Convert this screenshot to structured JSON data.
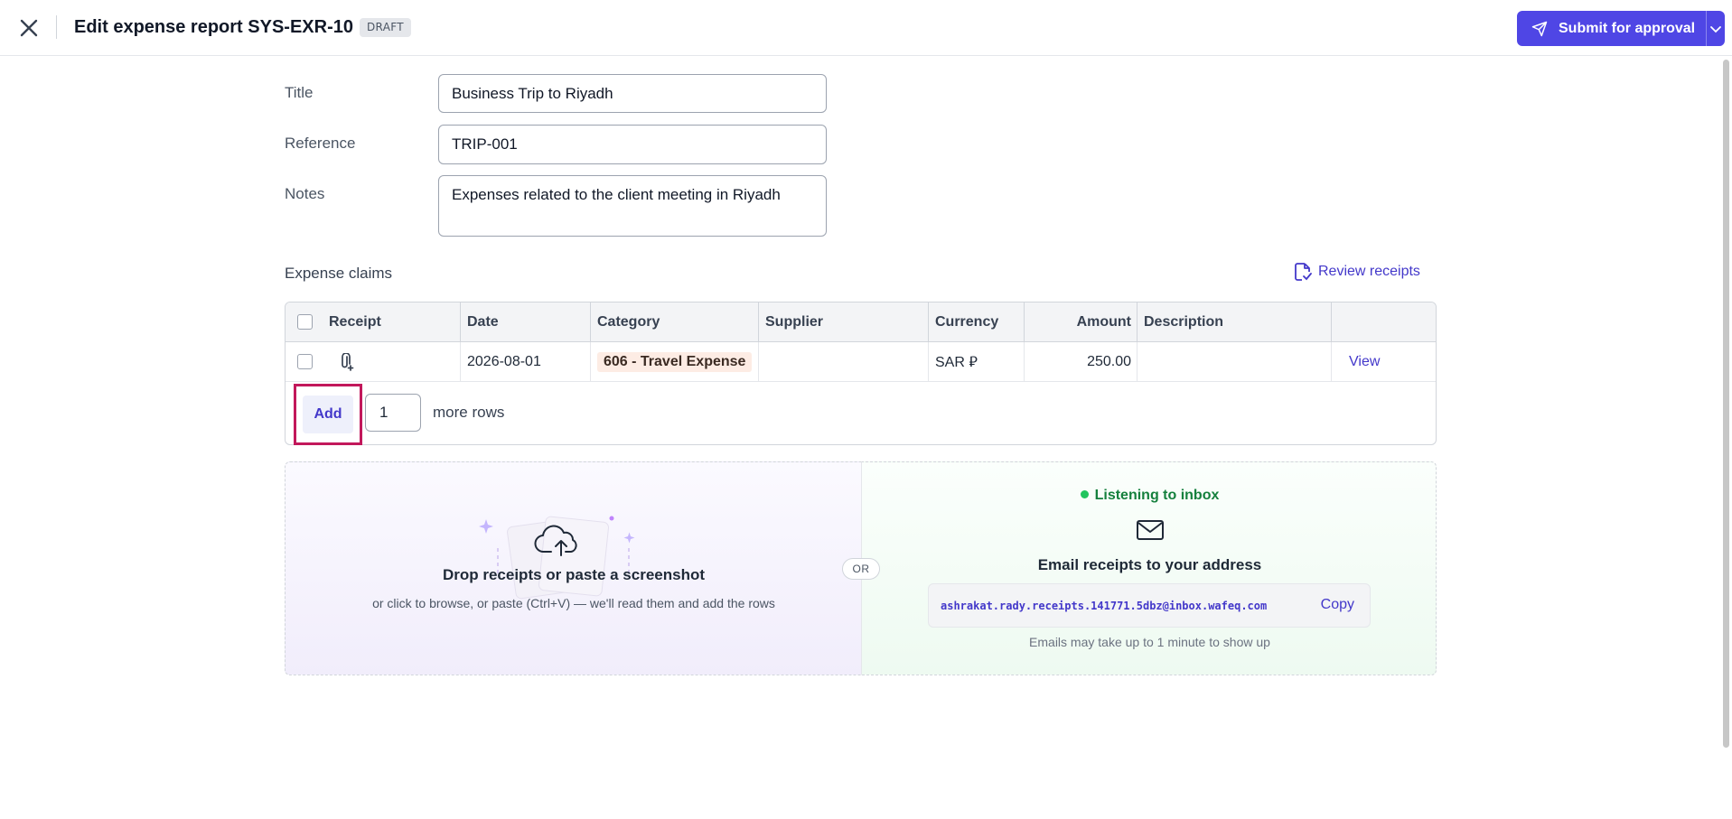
{
  "header": {
    "title": "Edit expense report SYS-EXR-10",
    "status_badge": "DRAFT",
    "submit_label": "Submit for approval"
  },
  "form": {
    "title_label": "Title",
    "title_value": "Business Trip to Riyadh",
    "reference_label": "Reference",
    "reference_value": "TRIP-001",
    "notes_label": "Notes",
    "notes_value": "Expenses related to the client meeting in Riyadh"
  },
  "claims": {
    "section_title": "Expense claims",
    "review_label": "Review receipts",
    "columns": {
      "receipt": "Receipt",
      "date": "Date",
      "category": "Category",
      "supplier": "Supplier",
      "currency": "Currency",
      "amount": "Amount",
      "description": "Description"
    },
    "rows": [
      {
        "date": "2026-08-01",
        "category": "606 - Travel Expense",
        "supplier": "",
        "currency": "SAR ⃁",
        "amount": "250.00",
        "description": "",
        "action": "View"
      }
    ],
    "add_label": "Add",
    "add_count": "1",
    "more_rows_label": "more rows"
  },
  "upload": {
    "drop_title": "Drop receipts or paste a screenshot",
    "drop_subtitle": "or click to browse, or paste (Ctrl+V) — we'll read them and add the rows",
    "or_label": "OR",
    "listening_label": "Listening to inbox",
    "email_title": "Email receipts to your address",
    "email_address": "ashrakat.rady.receipts.141771.5dbz@inbox.wafeq.com",
    "copy_label": "Copy",
    "email_note": "Emails may take up to 1 minute to show up"
  },
  "colors": {
    "primary": "#4f46e5",
    "link": "#4338ca",
    "highlight": "#c2185b",
    "status_green": "#22c55e"
  }
}
